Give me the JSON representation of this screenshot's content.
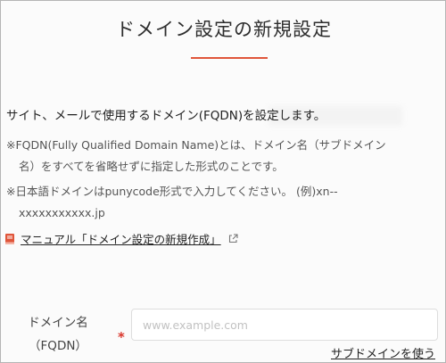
{
  "page": {
    "title": "ドメイン設定の新規設定",
    "accent_color": "#e0553a"
  },
  "intro": {
    "description": "サイト、メールで使用するドメイン(FQDN)を設定します。",
    "note1_line1": "※FQDN(Fully Qualified Domain Name)とは、ドメイン名（サブドメイン",
    "note1_line2": "名）をすべてを省略せずに指定した形式のことです。",
    "note2_line1": "※日本語ドメインはpunycode形式で入力してください。 (例)xn--",
    "note2_line2": "xxxxxxxxxxx.jp"
  },
  "manual": {
    "icon": "book-icon",
    "link_label": "マニュアル「ドメイン設定の新規作成」",
    "external_icon": "external-link-icon"
  },
  "form": {
    "domain_label_line1": "ドメイン名",
    "domain_label_line2": "（FQDN）",
    "required_mark": "*",
    "required_color": "#d9362b",
    "domain_placeholder": "www.example.com",
    "domain_value": "",
    "subdomain_link": "サブドメインを使う"
  }
}
